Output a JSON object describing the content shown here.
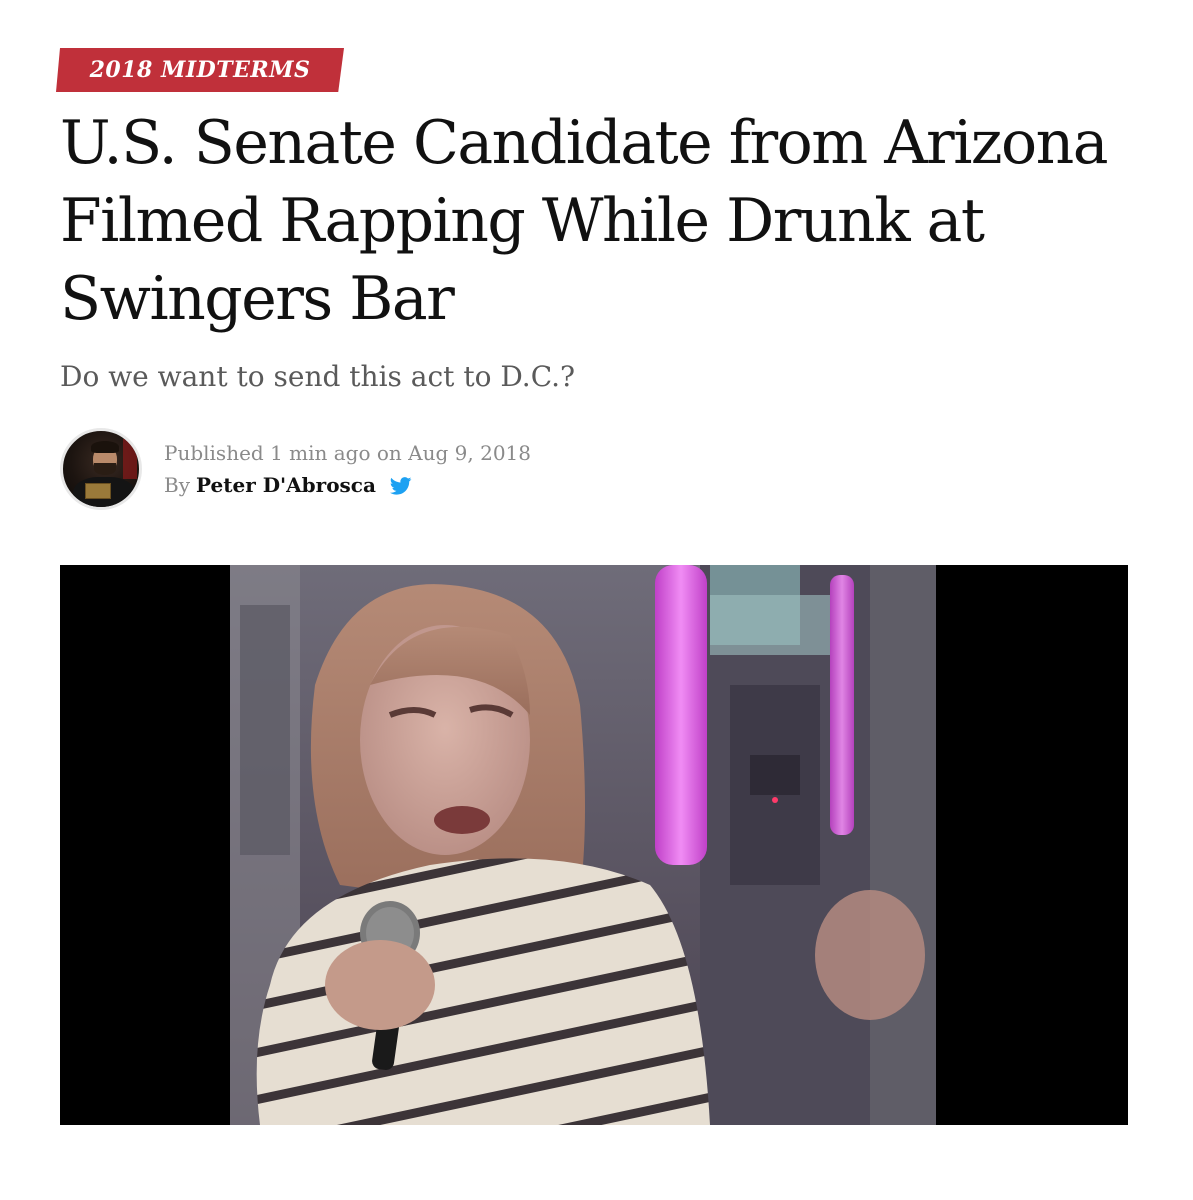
{
  "category": {
    "label": "2018 MIDTERMS",
    "color": "#c0303a"
  },
  "article": {
    "headline": "U.S. Senate Candidate from Arizona Filmed Rapping While Drunk at Swingers Bar",
    "dek": "Do we want to send this act to D.C.?"
  },
  "meta": {
    "published_prefix": "Published",
    "published_time": "1 min ago",
    "published_on": "on",
    "published_date": "Aug 9, 2018",
    "by_label": "By",
    "author_name": "Peter D'Abrosca",
    "social_icon": "twitter-icon",
    "social_color": "#1da1f2"
  },
  "media": {
    "type": "video",
    "letterbox_color": "#000000"
  }
}
